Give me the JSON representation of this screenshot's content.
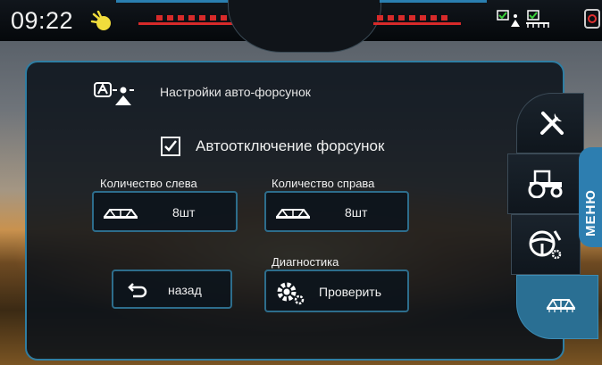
{
  "status_bar": {
    "time": "09:22",
    "icons": [
      "day-mode-icon",
      "section-indicators-left",
      "section-indicators-right",
      "nozzle-status-icon",
      "boom-status-icon",
      "gauge-icon"
    ]
  },
  "screen": {
    "title": "Настройки авто-форсунок",
    "auto_off_checkbox": {
      "label": "Автоотключение форсунок",
      "checked": true
    },
    "left_count": {
      "label": "Количество слева",
      "value": "8шт"
    },
    "right_count": {
      "label": "Количество справа",
      "value": "8шт"
    },
    "back_button": {
      "label": "назад"
    },
    "diagnostics": {
      "label": "Диагностика",
      "button_label": "Проверить"
    }
  },
  "side_menu": {
    "label": "МЕНЮ",
    "items": [
      "tools-icon",
      "tractor-icon",
      "steering-wheel-icon",
      "sprayer-boom-icon"
    ],
    "active_item": "sprayer-boom-icon"
  },
  "colors": {
    "accent": "#2d7eb0",
    "panel": "#0a121a",
    "sun_icon": "#f1dc3c"
  }
}
